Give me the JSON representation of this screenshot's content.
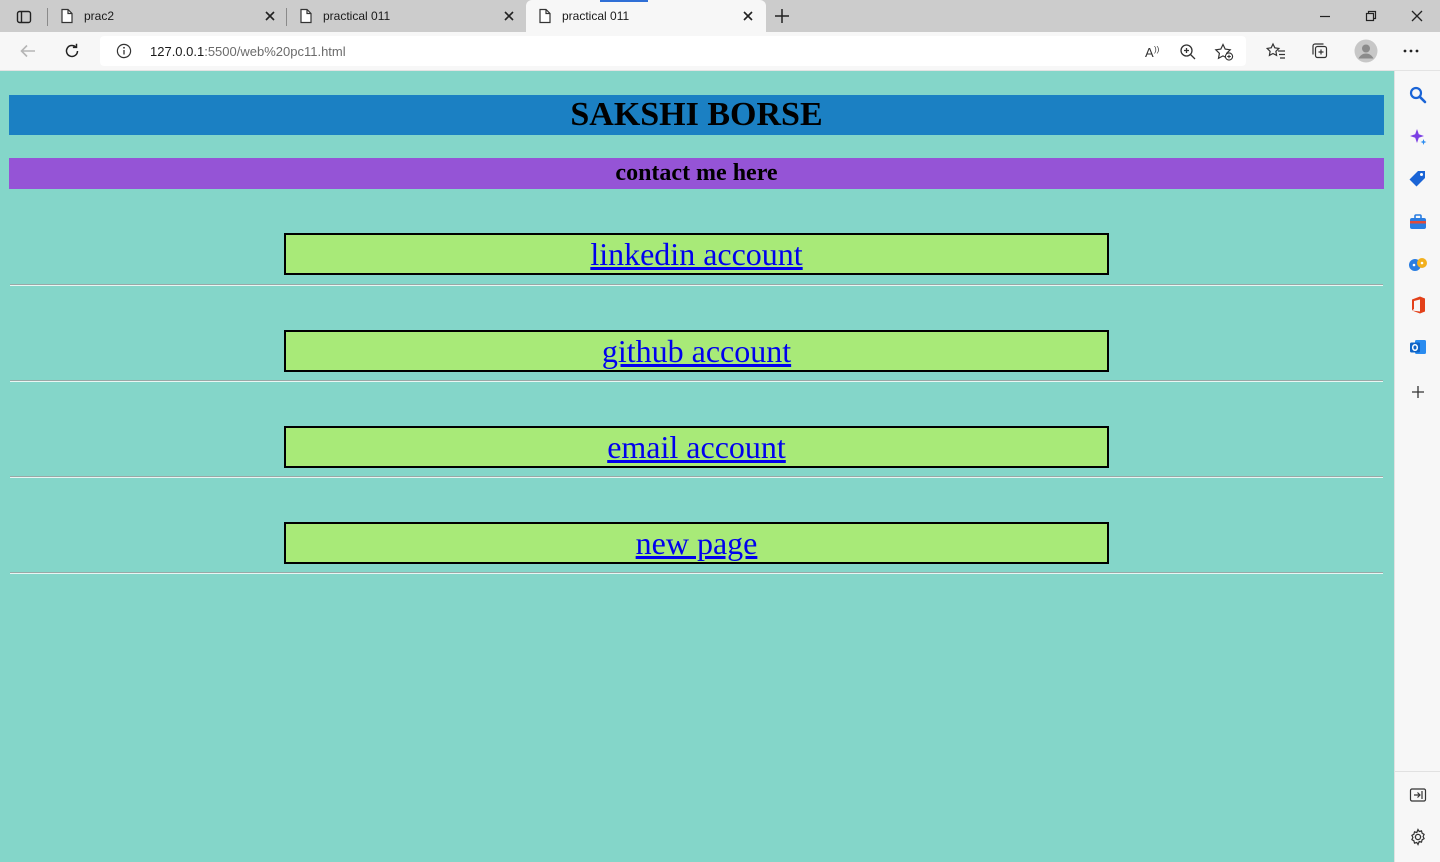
{
  "browser": {
    "tabs": [
      {
        "title": "prac2",
        "active": false
      },
      {
        "title": "practical 011",
        "active": false
      },
      {
        "title": "practical 011",
        "active": true
      }
    ],
    "address": {
      "host": "127.0.0.1",
      "rest": ":5500/web%20pc11.html"
    }
  },
  "page": {
    "title": "SAKSHI BORSE",
    "subtitle": "contact me here",
    "links": [
      {
        "label": "linkedin account"
      },
      {
        "label": "github account"
      },
      {
        "label": "email account"
      },
      {
        "label": "new page"
      }
    ]
  },
  "colors": {
    "page_background": "#84d6c9",
    "title_background": "#1b80c3",
    "subtitle_background": "#9554d6",
    "link_box_background": "#a8ea78",
    "link_text": "#0000ee"
  },
  "icons": {
    "tab_strip": [
      "tab-actions-icon",
      "page-icon",
      "close-icon",
      "new-tab-icon"
    ],
    "window": [
      "minimize-icon",
      "restore-icon",
      "close-icon"
    ],
    "toolbar": [
      "back-icon",
      "refresh-icon",
      "info-icon",
      "read-aloud-icon",
      "zoom-icon",
      "add-favorite-icon",
      "favorites-icon",
      "collections-icon",
      "profile-icon",
      "more-icon"
    ],
    "sidebar": [
      "search-icon",
      "copilot-icon",
      "shopping-icon",
      "tools-icon",
      "games-icon",
      "office-icon",
      "outlook-icon",
      "add-icon",
      "hide-sidebar-icon",
      "settings-icon"
    ]
  }
}
